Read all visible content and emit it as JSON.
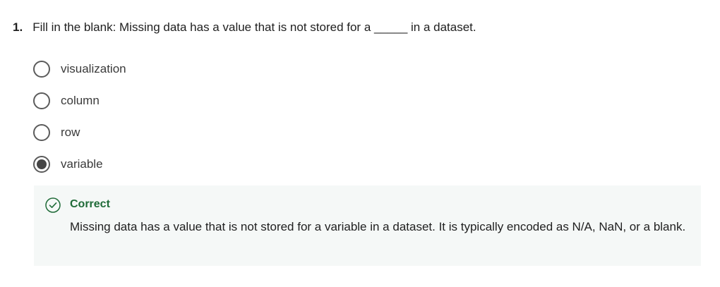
{
  "question": {
    "number": "1.",
    "text": "Fill in the blank: Missing data has a value that is not stored for a _____ in a dataset."
  },
  "options": [
    {
      "label": "visualization",
      "selected": false
    },
    {
      "label": "column",
      "selected": false
    },
    {
      "label": "row",
      "selected": false
    },
    {
      "label": "variable",
      "selected": true
    }
  ],
  "feedback": {
    "status": "Correct",
    "icon": "check-circle-icon",
    "message": "Missing data has a value that is not stored for a variable in a dataset. It is typically encoded as N/A, NaN, or a blank.",
    "colors": {
      "status": "#1f6b38",
      "background": "#f5f8f7"
    }
  }
}
